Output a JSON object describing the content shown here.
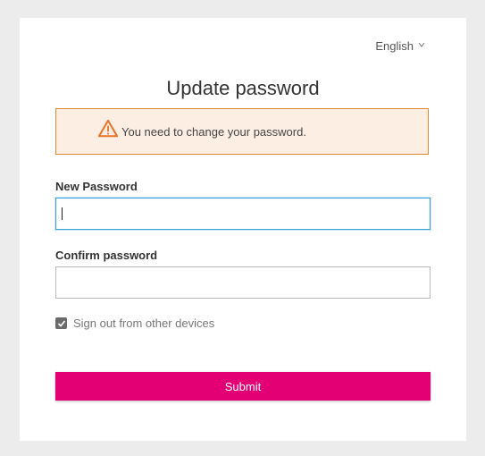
{
  "language": {
    "selected": "English",
    "chevron_icon": "chevron-down-icon"
  },
  "page": {
    "title": "Update password"
  },
  "alert": {
    "icon": "warning-icon",
    "message": "You need to change your password.",
    "border_color": "#e08a2e",
    "background_color": "#fdeee3"
  },
  "form": {
    "new_password": {
      "label": "New Password",
      "value": "",
      "focused": true
    },
    "confirm_password": {
      "label": "Confirm password",
      "value": ""
    },
    "sign_out_other_devices": {
      "label": "Sign out from other devices",
      "checked": true
    },
    "submit_label": "Submit"
  },
  "colors": {
    "accent": "#e20074",
    "focus_border": "#3aa1d9"
  }
}
